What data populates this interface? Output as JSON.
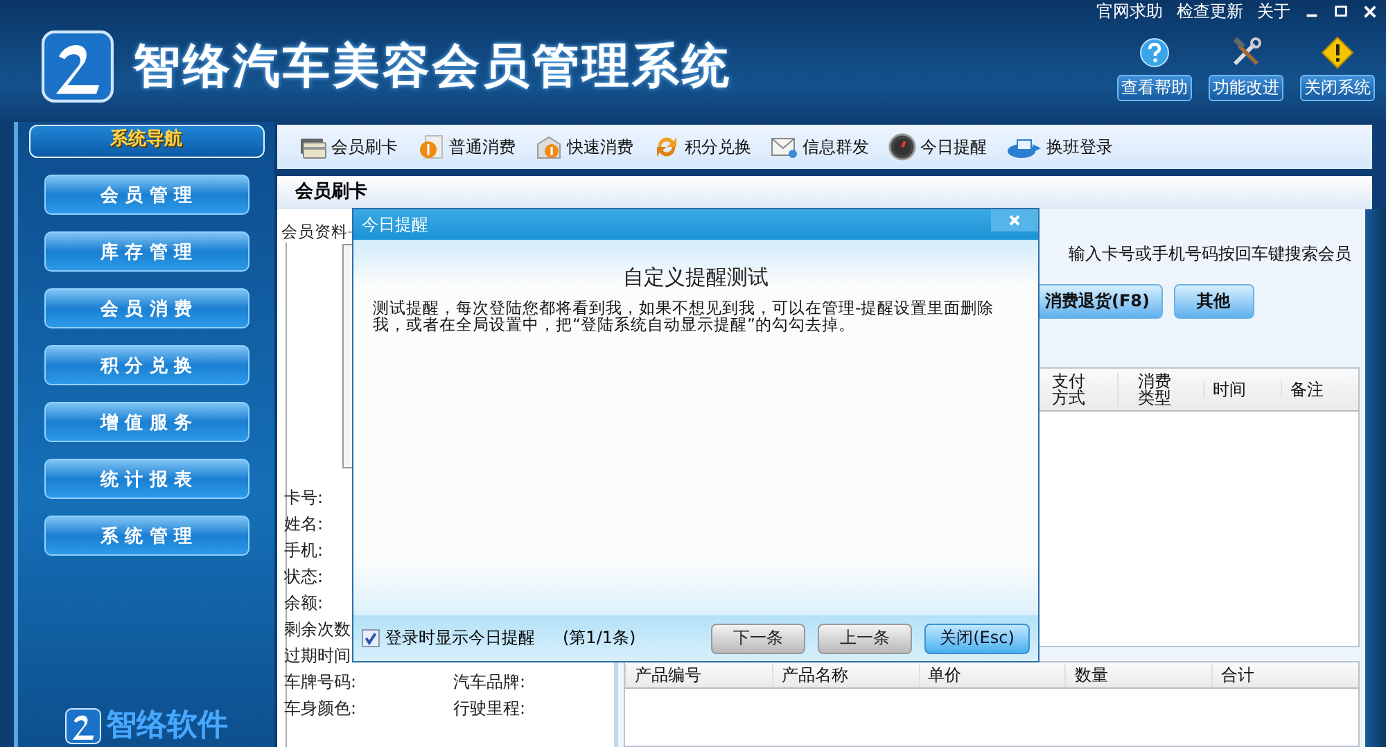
{
  "top_links": [
    "官网求助",
    "检查更新",
    "关于"
  ],
  "app_title": "智络汽车美容会员管理系统",
  "header_buttons": [
    {
      "kind": "help",
      "label": "查看帮助"
    },
    {
      "kind": "tools",
      "label": "功能改进"
    },
    {
      "kind": "warning",
      "label": "关闭系统"
    }
  ],
  "sidebar": {
    "title": "系统导航",
    "items": [
      "会 员 管 理",
      "库 存 管 理",
      "会 员 消 费",
      "积 分 兑 换",
      "增 值 服 务",
      "统 计 报 表",
      "系 统 管 理"
    ],
    "footer_logo": "智络软件"
  },
  "toolbar": [
    {
      "kind": "card",
      "label": "会员刷卡"
    },
    {
      "kind": "dollar",
      "label": "普通消费"
    },
    {
      "kind": "fast",
      "label": "快速消费"
    },
    {
      "kind": "exchange",
      "label": "积分兑换"
    },
    {
      "kind": "mail",
      "label": "信息群发"
    },
    {
      "kind": "clock",
      "label": "今日提醒"
    },
    {
      "kind": "login",
      "label": "换班登录"
    }
  ],
  "section_title": "会员刷卡",
  "member_panel": {
    "legend": "会员资料",
    "fields": [
      "卡号:",
      "姓名:",
      "手机:",
      "状态:",
      "余额:",
      "剩余次数",
      "过期时间"
    ],
    "vehicle_fields": [
      {
        "left": "车牌号码:",
        "right": "汽车品牌:"
      },
      {
        "left": "车身颜色:",
        "right": "行驶里程:"
      }
    ]
  },
  "search_hint": "输入卡号或手机号码按回车键搜索会员",
  "action_buttons": [
    "消费退货(F8)",
    "其他"
  ],
  "history_table": {
    "columns": [
      "支付方式",
      "消费类型",
      "时间",
      "备注"
    ]
  },
  "product_table": {
    "columns": [
      "产品编号",
      "产品名称",
      "单价",
      "数量",
      "合计"
    ]
  },
  "dialog": {
    "title": "今日提醒",
    "heading": "自定义提醒测试",
    "message": "测试提醒，每次登陆您都将看到我，如果不想见到我，可以在管理-提醒设置里面删除我，或者在全局设置中，把“登陆系统自动显示提醒”的勾勾去掉。",
    "show_on_login": {
      "label": "登录时显示今日提醒",
      "checked": true
    },
    "counter": "(第1/1条)",
    "buttons": [
      {
        "kind": "plain",
        "label": "下一条"
      },
      {
        "kind": "plain",
        "label": "上一条"
      },
      {
        "kind": "primary",
        "label": "关闭(Esc)"
      }
    ]
  }
}
